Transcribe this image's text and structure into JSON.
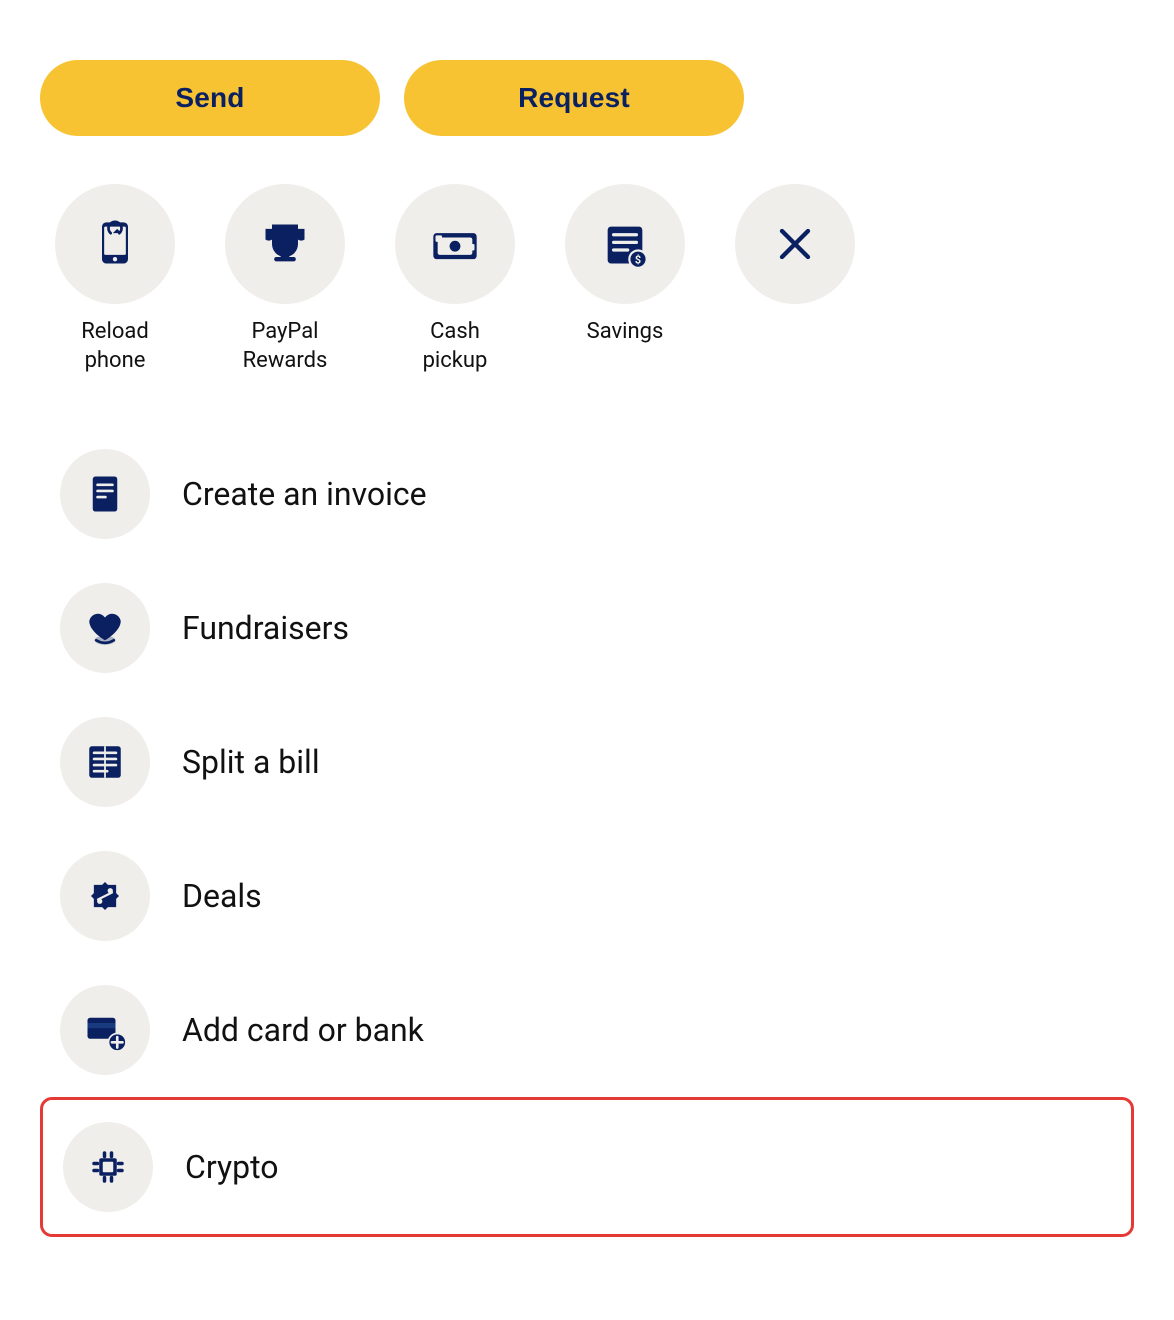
{
  "buttons": {
    "send_label": "Send",
    "request_label": "Request"
  },
  "quick_icons": [
    {
      "id": "reload-phone",
      "label": "Reload\nphone",
      "icon": "reload-phone-icon"
    },
    {
      "id": "paypal-rewards",
      "label": "PayPal\nRewards",
      "icon": "trophy-icon"
    },
    {
      "id": "cash-pickup",
      "label": "Cash\npickup",
      "icon": "cash-pickup-icon"
    },
    {
      "id": "savings",
      "label": "Savings",
      "icon": "savings-icon"
    },
    {
      "id": "close",
      "label": "",
      "icon": "close-icon"
    }
  ],
  "list_items": [
    {
      "id": "create-invoice",
      "label": "Create an invoice",
      "icon": "invoice-icon",
      "highlighted": false
    },
    {
      "id": "fundraisers",
      "label": "Fundraisers",
      "icon": "fundraisers-icon",
      "highlighted": false
    },
    {
      "id": "split-bill",
      "label": "Split a bill",
      "icon": "split-bill-icon",
      "highlighted": false
    },
    {
      "id": "deals",
      "label": "Deals",
      "icon": "deals-icon",
      "highlighted": false
    },
    {
      "id": "add-card-bank",
      "label": "Add card or bank",
      "icon": "add-card-icon",
      "highlighted": false
    },
    {
      "id": "crypto",
      "label": "Crypto",
      "icon": "crypto-icon",
      "highlighted": true
    }
  ],
  "colors": {
    "accent_yellow": "#F7C332",
    "navy": "#0a2060",
    "icon_bg": "#f0eeeb",
    "highlight_border": "#e53935"
  }
}
